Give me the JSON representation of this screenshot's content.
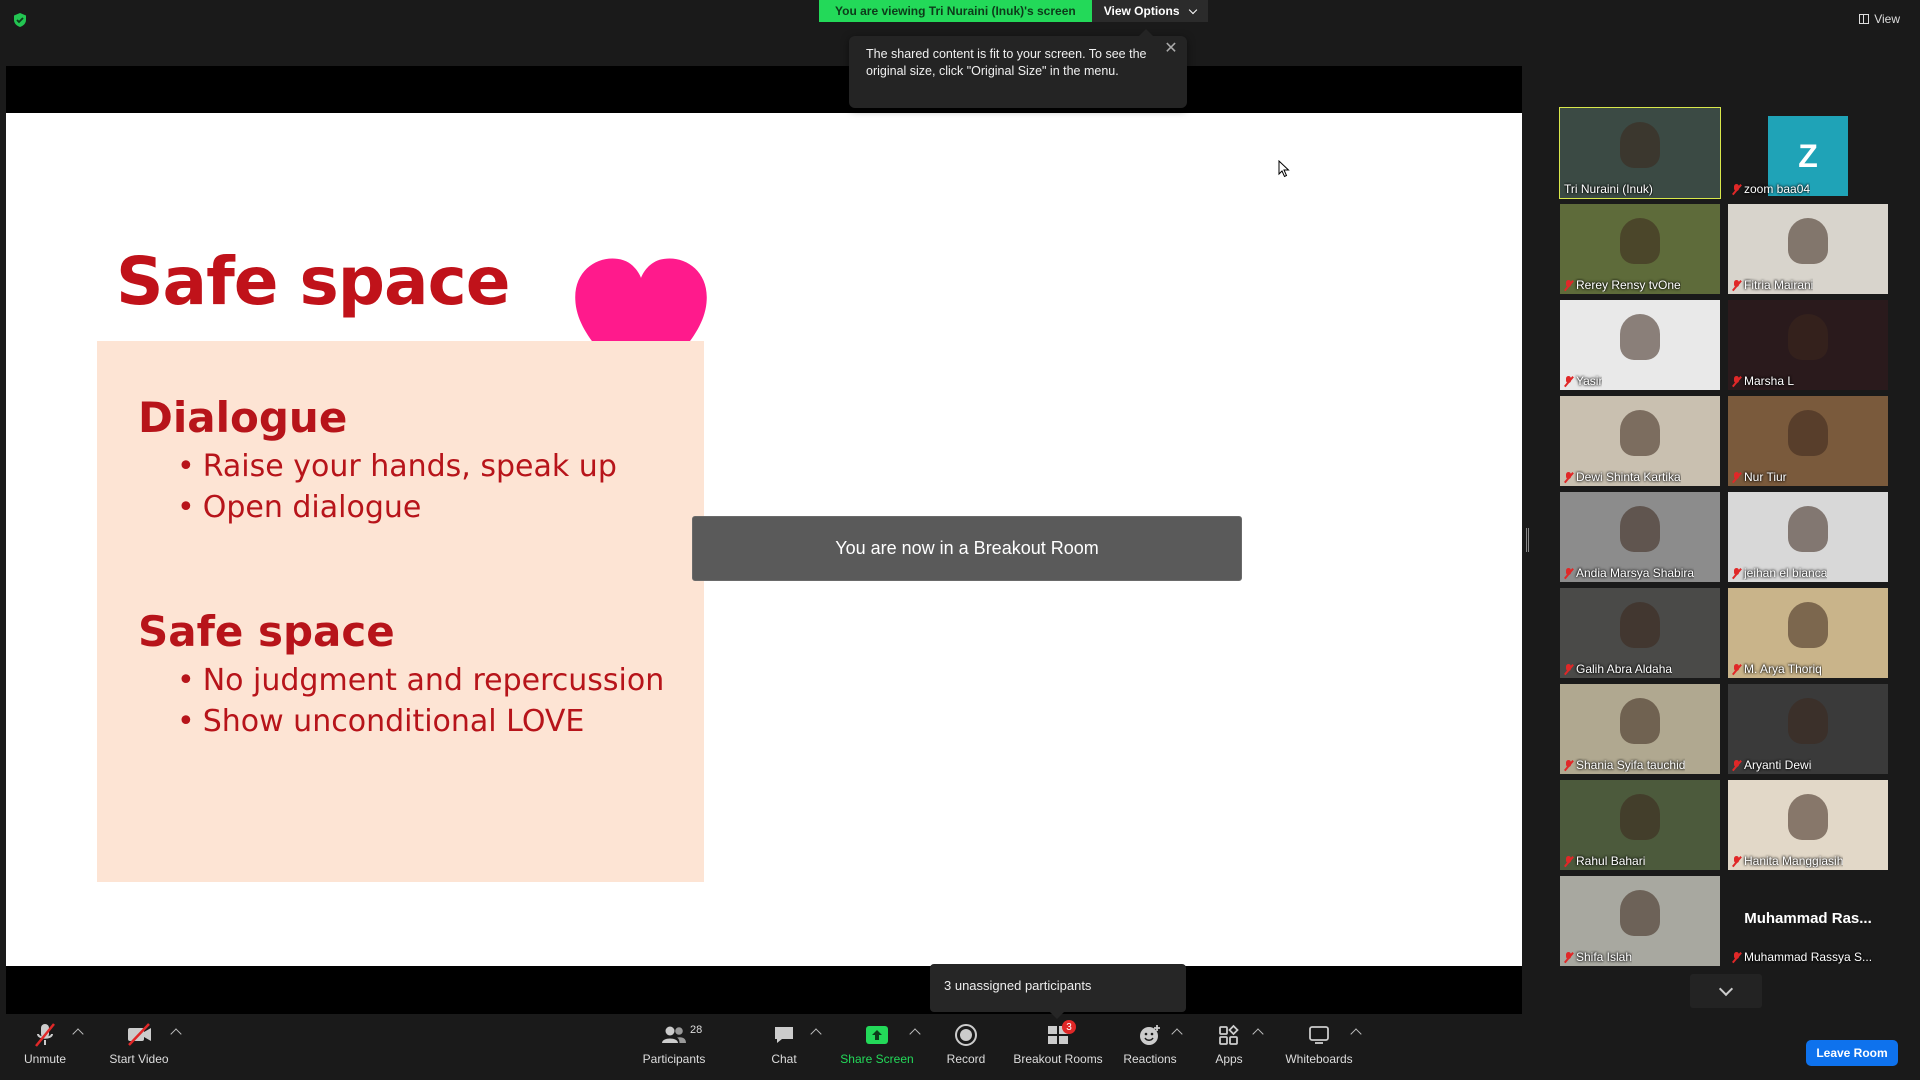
{
  "banner": {
    "viewing_text": "You are viewing Tri Nuraini (Inuk)'s screen",
    "view_options_label": "View Options"
  },
  "top_right": {
    "view_label": "View"
  },
  "tooltip": {
    "text": "The shared content is fit to your screen. To see the original size, click \"Original Size\" in the menu."
  },
  "slide": {
    "title": "Safe space",
    "sections": [
      {
        "heading": "Dialogue",
        "items": [
          "Raise your hands, speak up",
          "Open dialogue"
        ]
      },
      {
        "heading": "Safe space",
        "items": [
          "No judgment and repercussion",
          "Show unconditional LOVE"
        ]
      }
    ],
    "heart_color": "#ff1a8c"
  },
  "breakout_notice": "You are now in a Breakout Room",
  "unassigned": "3 unassigned participants",
  "gallery": {
    "tiles": [
      {
        "name": "Tri Nuraini (Inuk)",
        "muted": false,
        "active": true,
        "bg": "#3b4a44"
      },
      {
        "name": "zoom baa04",
        "muted": true,
        "avatar_letter": "Z",
        "bg": "#1a1a1a"
      },
      {
        "name": "Rerey Rensy tvOne",
        "muted": true,
        "bg": "#5e6b3a"
      },
      {
        "name": "Fitria Mairani",
        "muted": true,
        "bg": "#d8d4cc"
      },
      {
        "name": "Yasir",
        "muted": true,
        "bg": "#e9e9e9"
      },
      {
        "name": "Marsha L",
        "muted": true,
        "bg": "#2a1a1c"
      },
      {
        "name": "Dewi Shinta Kartika",
        "muted": true,
        "bg": "#c9c0b0"
      },
      {
        "name": "Nur Tiur",
        "muted": true,
        "bg": "#7a5a3c"
      },
      {
        "name": "Andia Marsya Shabira",
        "muted": true,
        "bg": "#8c8c8c"
      },
      {
        "name": "jeihan el bianca",
        "muted": true,
        "bg": "#d8d8d8"
      },
      {
        "name": "Galih Abra Aldaha",
        "muted": true,
        "bg": "#4a4a48"
      },
      {
        "name": "M. Arya Thoriq",
        "muted": true,
        "bg": "#c9b48a"
      },
      {
        "name": "Shania Syifa tauchid",
        "muted": true,
        "bg": "#b0a890"
      },
      {
        "name": "Aryanti Dewi",
        "muted": true,
        "bg": "#3a3a3a"
      },
      {
        "name": "Rahul Bahari",
        "muted": true,
        "bg": "#4c5a3c"
      },
      {
        "name": "Hanita Manggiasih",
        "muted": true,
        "bg": "#e2d8c8"
      },
      {
        "name": "Shifa Islah",
        "muted": true,
        "bg": "#a8a8a0"
      },
      {
        "name": "Muhammad Rassya S...",
        "muted": true,
        "big_name": "Muhammad Ras...",
        "bg": "#1a1a1a"
      }
    ]
  },
  "toolbar": {
    "unmute": "Unmute",
    "start_video": "Start Video",
    "participants": "Participants",
    "participants_count": "28",
    "chat": "Chat",
    "share_screen": "Share Screen",
    "record": "Record",
    "breakout_rooms": "Breakout Rooms",
    "breakout_badge": "3",
    "reactions": "Reactions",
    "apps": "Apps",
    "whiteboards": "Whiteboards",
    "leave_room": "Leave Room",
    "share_color": "#23d959",
    "leave_color": "#0e72ed"
  }
}
